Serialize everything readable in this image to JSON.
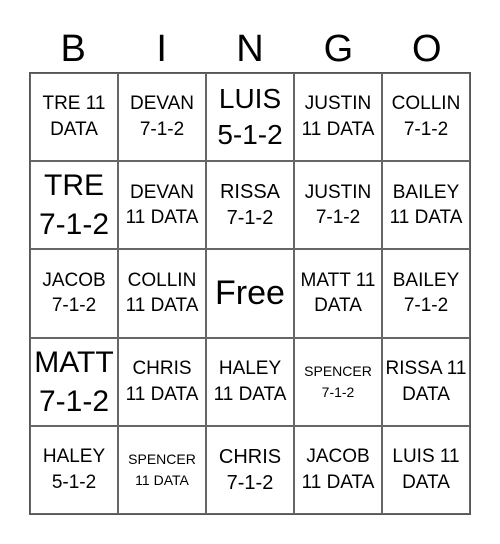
{
  "header": [
    "B",
    "I",
    "N",
    "G",
    "O"
  ],
  "cells": [
    {
      "text": "TRE 11 DATA",
      "size": "norm"
    },
    {
      "text": "DEVAN 7-1-2",
      "size": "norm"
    },
    {
      "text": "LUIS 5-1-2",
      "size": "big"
    },
    {
      "text": "JUSTIN 11 DATA",
      "size": "norm"
    },
    {
      "text": "COLLIN 7-1-2",
      "size": "norm"
    },
    {
      "text": "TRE 7-1-2",
      "size": "huge"
    },
    {
      "text": "DEVAN 11 DATA",
      "size": "norm"
    },
    {
      "text": "RISSA 7-1-2",
      "size": "med"
    },
    {
      "text": "JUSTIN 7-1-2",
      "size": "norm"
    },
    {
      "text": "BAILEY 11 DATA",
      "size": "norm"
    },
    {
      "text": "JACOB 7-1-2",
      "size": "norm"
    },
    {
      "text": "COLLIN 11 DATA",
      "size": "norm"
    },
    {
      "text": "Free",
      "size": "free"
    },
    {
      "text": "MATT 11 DATA",
      "size": "norm"
    },
    {
      "text": "BAILEY 7-1-2",
      "size": "norm"
    },
    {
      "text": "MATT 7-1-2",
      "size": "huge"
    },
    {
      "text": "CHRIS 11 DATA",
      "size": "norm"
    },
    {
      "text": "HALEY 11 DATA",
      "size": "norm"
    },
    {
      "text": "SPENCER 7-1-2",
      "size": "small"
    },
    {
      "text": "RISSA 11 DATA",
      "size": "norm"
    },
    {
      "text": "HALEY 5-1-2",
      "size": "norm"
    },
    {
      "text": "SPENCER 11 DATA",
      "size": "small"
    },
    {
      "text": "CHRIS 7-1-2",
      "size": "med"
    },
    {
      "text": "JACOB 11 DATA",
      "size": "norm"
    },
    {
      "text": "LUIS 11 DATA",
      "size": "norm"
    }
  ]
}
